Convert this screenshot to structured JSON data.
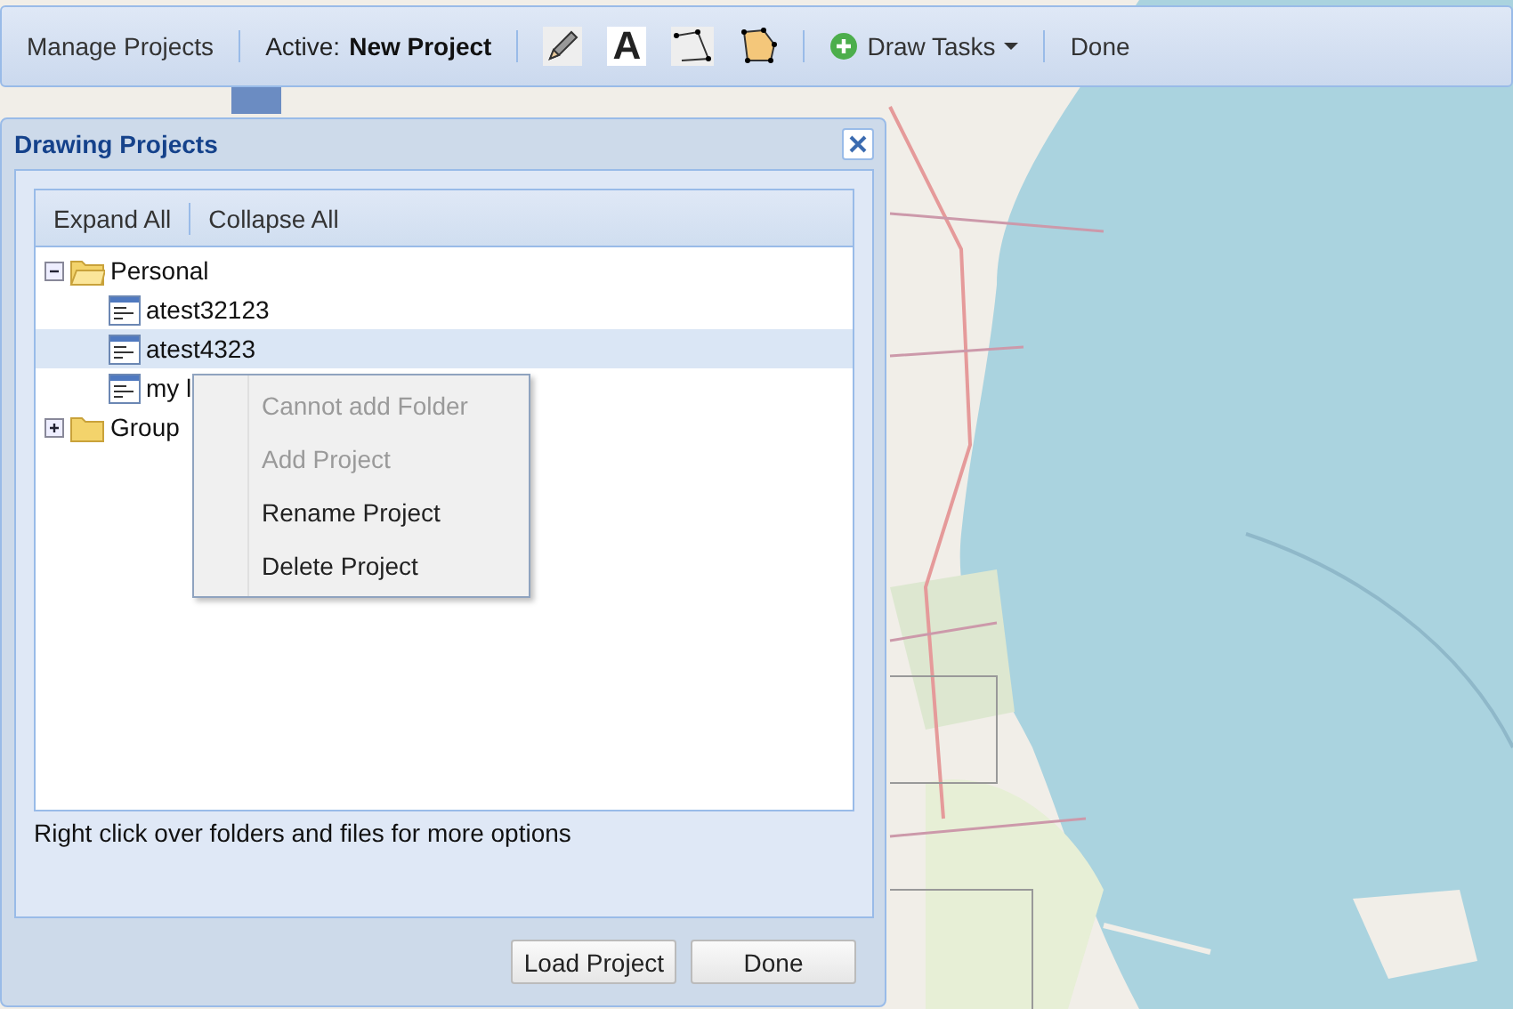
{
  "toolbar": {
    "manage": "Manage Projects",
    "active_label": "Active:",
    "active_project": "New Project",
    "tools": [
      {
        "kind": "pencil"
      },
      {
        "kind": "text",
        "glyph": "A"
      },
      {
        "kind": "line"
      },
      {
        "kind": "polygon"
      }
    ],
    "draw_tasks": "Draw Tasks",
    "done": "Done"
  },
  "dialog": {
    "title": "Drawing Projects",
    "tree_toolbar": [
      "Expand All",
      "Collapse All"
    ],
    "tree": [
      {
        "kind": "folder",
        "label": "Personal",
        "expanded": true,
        "selected": false,
        "children": [
          {
            "kind": "project",
            "label": "atest32123",
            "selected": false
          },
          {
            "kind": "project",
            "label": "atest4323",
            "selected": true
          },
          {
            "kind": "project",
            "label": "my l",
            "selected": false
          }
        ]
      },
      {
        "kind": "folder",
        "label": "Group",
        "expanded": false,
        "selected": false
      }
    ],
    "hint": "Right click over folders and files for more options",
    "buttons": [
      "Load Project",
      "Done"
    ]
  },
  "context_menu": {
    "items": [
      {
        "label": "Cannot add Folder",
        "disabled": true
      },
      {
        "label": "Add Project",
        "disabled": true
      },
      {
        "label": "Rename Project",
        "disabled": false
      },
      {
        "label": "Delete Project",
        "disabled": false
      }
    ]
  }
}
